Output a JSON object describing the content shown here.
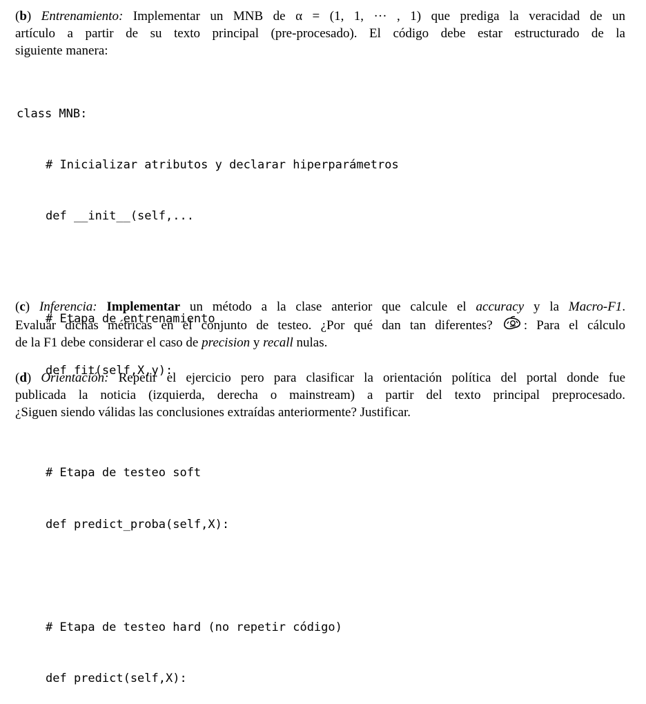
{
  "part_b": {
    "label": "b",
    "title": "Entrenamiento:",
    "line1_rest": "Implementar un MNB de α = (1, 1, ··· , 1) que prediga la veracidad de un",
    "line2": "artículo a partir de su texto principal (pre-procesado). El código debe estar estructurado de la",
    "line3": "siguiente manera:"
  },
  "code": {
    "lines": [
      "class MNB:",
      "# Inicializar atributos y declarar hiperparámetros",
      "def __init__(self,...",
      "",
      "# Etapa de entrenamiento",
      "def fit(self,X,y):",
      "",
      "# Etapa de testeo soft",
      "def predict_proba(self,X):",
      "",
      "# Etapa de testeo hard (no repetir código)",
      "def predict(self,X):"
    ]
  },
  "part_c": {
    "label": "c",
    "title": "Inferencia:",
    "strong": "Implementar",
    "text1": "un método a la clase anterior que calcule el",
    "accuracy": "accuracy",
    "text2": "y la",
    "macro": "Macro-F1",
    "line2_before": "Evaluar dichas métricas en el conjunto de testeo. ¿Por qué dan tan diferentes?",
    "line2_after": ": Para el cálculo",
    "line3_before": "de la F1 debe considerar el caso de",
    "precision": "precision",
    "and": "y",
    "recall": "recall",
    "line3_after": "nulas."
  },
  "part_d": {
    "label": "d",
    "title": "Orientación:",
    "line1_rest": "Repetir el ejercicio pero para clasificar la orientación política del portal donde fue",
    "line2": "publicada la noticia (izquierda, derecha o mainstream) a partir del texto principal preprocesado.",
    "line3": "¿Siguen siendo válidas las conclusiones extraídas anteriormente? Justificar."
  }
}
